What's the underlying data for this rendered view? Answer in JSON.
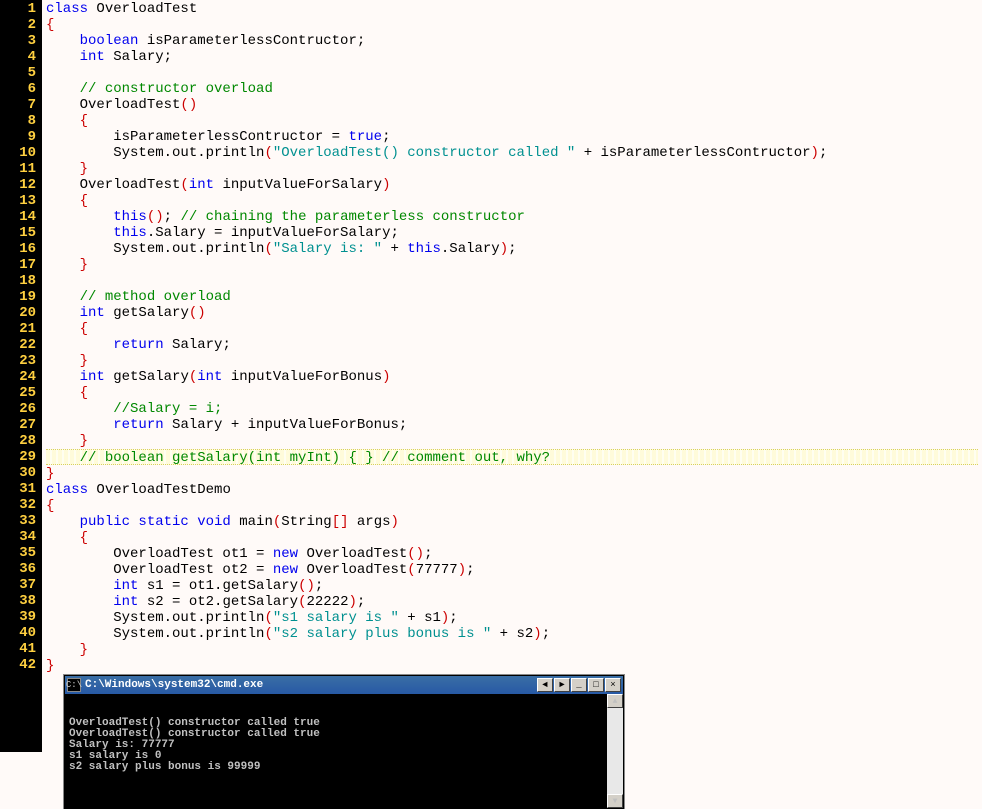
{
  "editor": {
    "highlighted_line_index": 28,
    "lines": [
      [
        [
          "kw",
          "class"
        ],
        [
          "def",
          " OverloadTest"
        ]
      ],
      [
        [
          "brc",
          "{"
        ]
      ],
      [
        [
          "def",
          "    "
        ],
        [
          "kw",
          "boolean"
        ],
        [
          "def",
          " isParameterlessContructor;"
        ]
      ],
      [
        [
          "def",
          "    "
        ],
        [
          "kw",
          "int"
        ],
        [
          "def",
          " Salary;"
        ]
      ],
      [
        [
          "def",
          ""
        ]
      ],
      [
        [
          "def",
          "    "
        ],
        [
          "com",
          "// constructor overload"
        ]
      ],
      [
        [
          "def",
          "    OverloadTest"
        ],
        [
          "brc",
          "()"
        ]
      ],
      [
        [
          "def",
          "    "
        ],
        [
          "brc",
          "{"
        ]
      ],
      [
        [
          "def",
          "        isParameterlessContructor = "
        ],
        [
          "kw",
          "true"
        ],
        [
          "def",
          ";"
        ]
      ],
      [
        [
          "def",
          "        System.out.println"
        ],
        [
          "brc",
          "("
        ],
        [
          "str",
          "\"OverloadTest() constructor called \""
        ],
        [
          "def",
          " + isParameterlessContructor"
        ],
        [
          "brc",
          ")"
        ],
        [
          "def",
          ";"
        ]
      ],
      [
        [
          "def",
          "    "
        ],
        [
          "brc",
          "}"
        ]
      ],
      [
        [
          "def",
          "    OverloadTest"
        ],
        [
          "brc",
          "("
        ],
        [
          "kw",
          "int"
        ],
        [
          "def",
          " inputValueForSalary"
        ],
        [
          "brc",
          ")"
        ]
      ],
      [
        [
          "def",
          "    "
        ],
        [
          "brc",
          "{"
        ]
      ],
      [
        [
          "def",
          "        "
        ],
        [
          "kw",
          "this"
        ],
        [
          "brc",
          "()"
        ],
        [
          "def",
          "; "
        ],
        [
          "com",
          "// chaining the parameterless constructor"
        ]
      ],
      [
        [
          "def",
          "        "
        ],
        [
          "kw",
          "this"
        ],
        [
          "def",
          ".Salary = inputValueForSalary;"
        ]
      ],
      [
        [
          "def",
          "        System.out.println"
        ],
        [
          "brc",
          "("
        ],
        [
          "str",
          "\"Salary is: \""
        ],
        [
          "def",
          " + "
        ],
        [
          "kw",
          "this"
        ],
        [
          "def",
          ".Salary"
        ],
        [
          "brc",
          ")"
        ],
        [
          "def",
          ";"
        ]
      ],
      [
        [
          "def",
          "    "
        ],
        [
          "brc",
          "}"
        ]
      ],
      [
        [
          "def",
          ""
        ]
      ],
      [
        [
          "def",
          "    "
        ],
        [
          "com",
          "// method overload"
        ]
      ],
      [
        [
          "def",
          "    "
        ],
        [
          "kw",
          "int"
        ],
        [
          "def",
          " getSalary"
        ],
        [
          "brc",
          "()"
        ]
      ],
      [
        [
          "def",
          "    "
        ],
        [
          "brc",
          "{"
        ]
      ],
      [
        [
          "def",
          "        "
        ],
        [
          "kw",
          "return"
        ],
        [
          "def",
          " Salary;"
        ]
      ],
      [
        [
          "def",
          "    "
        ],
        [
          "brc",
          "}"
        ]
      ],
      [
        [
          "def",
          "    "
        ],
        [
          "kw",
          "int"
        ],
        [
          "def",
          " getSalary"
        ],
        [
          "brc",
          "("
        ],
        [
          "kw",
          "int"
        ],
        [
          "def",
          " inputValueForBonus"
        ],
        [
          "brc",
          ")"
        ]
      ],
      [
        [
          "def",
          "    "
        ],
        [
          "brc",
          "{"
        ]
      ],
      [
        [
          "def",
          "        "
        ],
        [
          "com",
          "//Salary = i;"
        ]
      ],
      [
        [
          "def",
          "        "
        ],
        [
          "kw",
          "return"
        ],
        [
          "def",
          " Salary + inputValueForBonus;"
        ]
      ],
      [
        [
          "def",
          "    "
        ],
        [
          "brc",
          "}"
        ]
      ],
      [
        [
          "def",
          "    "
        ],
        [
          "com",
          "// boolean getSalary(int myInt) { } // comment out, why?"
        ]
      ],
      [
        [
          "brc",
          "}"
        ]
      ],
      [
        [
          "kw",
          "class"
        ],
        [
          "def",
          " OverloadTestDemo"
        ]
      ],
      [
        [
          "brc",
          "{"
        ]
      ],
      [
        [
          "def",
          "    "
        ],
        [
          "kw",
          "public static void"
        ],
        [
          "def",
          " main"
        ],
        [
          "brc",
          "("
        ],
        [
          "def",
          "String"
        ],
        [
          "brc",
          "[]"
        ],
        [
          "def",
          " args"
        ],
        [
          "brc",
          ")"
        ]
      ],
      [
        [
          "def",
          "    "
        ],
        [
          "brc",
          "{"
        ]
      ],
      [
        [
          "def",
          "        OverloadTest ot1 = "
        ],
        [
          "kw",
          "new"
        ],
        [
          "def",
          " OverloadTest"
        ],
        [
          "brc",
          "()"
        ],
        [
          "def",
          ";"
        ]
      ],
      [
        [
          "def",
          "        OverloadTest ot2 = "
        ],
        [
          "kw",
          "new"
        ],
        [
          "def",
          " OverloadTest"
        ],
        [
          "brc",
          "("
        ],
        [
          "def",
          "77777"
        ],
        [
          "brc",
          ")"
        ],
        [
          "def",
          ";"
        ]
      ],
      [
        [
          "def",
          "        "
        ],
        [
          "kw",
          "int"
        ],
        [
          "def",
          " s1 = ot1.getSalary"
        ],
        [
          "brc",
          "()"
        ],
        [
          "def",
          ";"
        ]
      ],
      [
        [
          "def",
          "        "
        ],
        [
          "kw",
          "int"
        ],
        [
          "def",
          " s2 = ot2.getSalary"
        ],
        [
          "brc",
          "("
        ],
        [
          "def",
          "22222"
        ],
        [
          "brc",
          ")"
        ],
        [
          "def",
          ";"
        ]
      ],
      [
        [
          "def",
          "        System.out.println"
        ],
        [
          "brc",
          "("
        ],
        [
          "str",
          "\"s1 salary is \""
        ],
        [
          "def",
          " + s1"
        ],
        [
          "brc",
          ")"
        ],
        [
          "def",
          ";"
        ]
      ],
      [
        [
          "def",
          "        System.out.println"
        ],
        [
          "brc",
          "("
        ],
        [
          "str",
          "\"s2 salary plus bonus is \""
        ],
        [
          "def",
          " + s2"
        ],
        [
          "brc",
          ")"
        ],
        [
          "def",
          ";"
        ]
      ],
      [
        [
          "def",
          "    "
        ],
        [
          "brc",
          "}"
        ]
      ],
      [
        [
          "brc",
          "}"
        ]
      ]
    ]
  },
  "console": {
    "icon_label": "C:\\",
    "title": "C:\\Windows\\system32\\cmd.exe",
    "buttons": {
      "b1": "◄",
      "b2": "►",
      "minimize": "_",
      "maximize": "□",
      "close": "×"
    },
    "scroll": {
      "up": "▲",
      "down": "▼"
    },
    "output": [
      "OverloadTest() constructor called true",
      "OverloadTest() constructor called true",
      "Salary is: 77777",
      "s1 salary is 0",
      "s2 salary plus bonus is 99999"
    ]
  }
}
